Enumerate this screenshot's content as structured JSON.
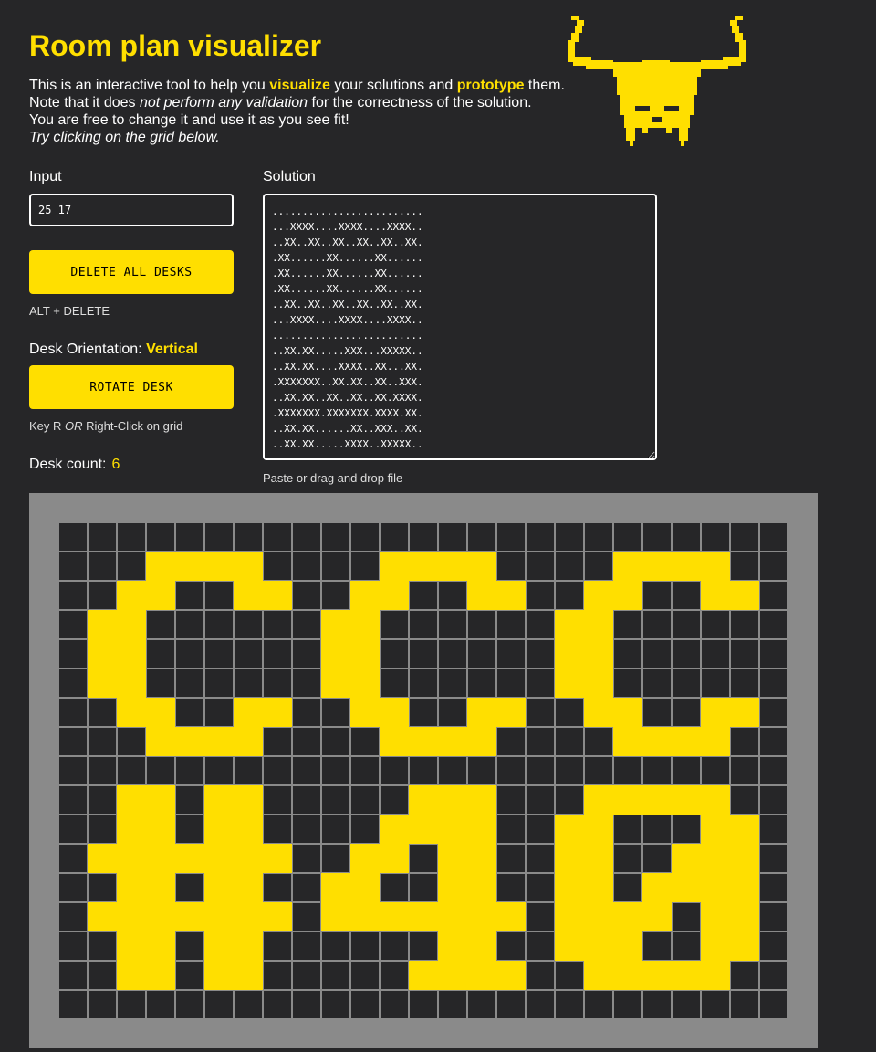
{
  "page": {
    "title": "Room plan visualizer",
    "intro": {
      "l1_a": "This is an interactive tool to help you ",
      "l1_hl1": "visualize",
      "l1_b": " your solutions and ",
      "l1_hl2": "prototype",
      "l1_c": " them.",
      "l2_a": "Note that it does ",
      "l2_em": "not perform any validation",
      "l2_b": " for the correctness of the solution.",
      "l3": "You are free to change it and use it as you see fit!",
      "l4": "Try clicking on the grid below."
    }
  },
  "logo": {
    "icon": "horned-helmet-icon",
    "color": "#ffdf00"
  },
  "controls": {
    "input_label": "Input",
    "input_value": "25 17",
    "delete_button": "DELETE ALL DESKS",
    "delete_shortcut": "ALT + DELETE",
    "orientation_label": "Desk Orientation:",
    "orientation_value": "Vertical",
    "rotate_button": "ROTATE DESK",
    "rotate_hint_a": "Key R ",
    "rotate_hint_or": "OR",
    "rotate_hint_b": " Right-Click on grid",
    "desk_count_label": "Desk count:",
    "desk_count_value": "6"
  },
  "solution": {
    "label": "Solution",
    "text": ".........................\n...XXXX....XXXX....XXXX..\n..XX..XX..XX..XX..XX..XX.\n.XX......XX......XX......\n.XX......XX......XX......\n.XX......XX......XX......\n..XX..XX..XX..XX..XX..XX.\n...XXXX....XXXX....XXXX..\n.........................\n..XX.XX.....XXX...XXXXX..\n..XX.XX....XXXX..XX...XX.\n.XXXXXXX..XX.XX..XX..XXX.\n..XX.XX..XX..XX..XX.XXXX.\n.XXXXXXX.XXXXXXX.XXXX.XX.\n..XX.XX......XX..XXX..XX.\n..XX.XX.....XXXX..XXXXX..\n.........................",
    "hint": "Paste or drag and drop file"
  },
  "grid": {
    "cols": 25,
    "rows": 17,
    "empty_color": "#262628",
    "desk_color": "#ffdf00",
    "line_color": "#8a8a8a"
  },
  "colors": {
    "accent": "#ffdf00",
    "background": "#262628"
  }
}
